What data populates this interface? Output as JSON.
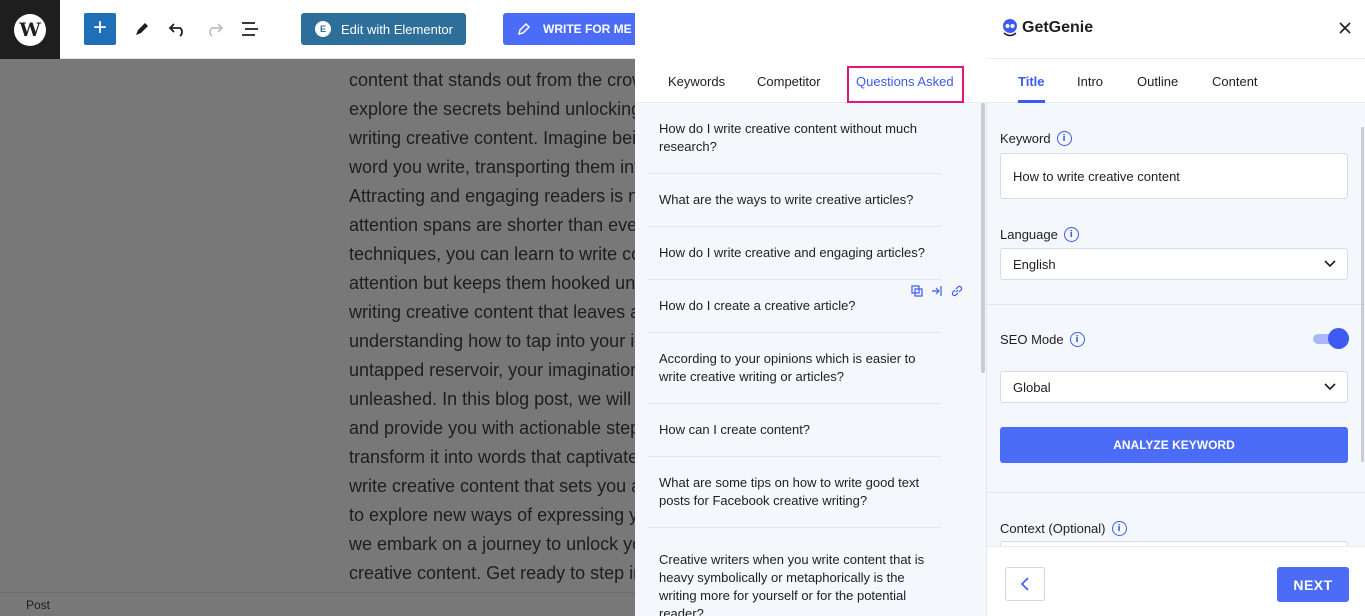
{
  "toolbar": {
    "elementor_label": "Edit with Elementor",
    "write_label": "WRITE FOR ME"
  },
  "editor": {
    "lines": [
      "content that stands out from the crowd? In this blog post, we'll",
      "explore the secrets behind unlocking your creative potential and",
      "writing creative content. Imagine being able to captivate readers with every",
      "word you write, transporting them into a world of imagination.",
      "Attracting and engaging readers is no easy task, especially when",
      "attention spans are shorter than ever. But with the right",
      "techniques, you can learn to write content that not only grabs",
      "attention but keeps them hooked until the very end. The key to",
      "writing creative content that leaves a lasting impression lies in",
      "understanding how to tap into your imagination. Like an",
      "untapped reservoir, your imagination holds endless possibilities waiting to be",
      "unleashed. In this blog post, we will take you on a journey",
      "and provide you with actionable steps to harness your creativity and",
      "transform it into words that captivate. Discover how to",
      "write creative content that sets you apart. Get ready",
      "to explore new ways of expressing yourself. Together,",
      "we embark on a journey to unlock your potential for",
      "creative content. Get ready to step into a world of creativity."
    ],
    "status": "Post"
  },
  "questions_panel": {
    "tabs": [
      "Keywords",
      "Competitor",
      "Questions Asked"
    ],
    "active_tab": "Questions Asked",
    "items": [
      "How do I write creative content without much research?",
      "What are the ways to write creative articles?",
      "How do I write creative and engaging articles?",
      "How do I create a creative article?",
      "According to your opinions which is easier to write creative writing or articles?",
      "How can I create content?",
      "What are some tips on how to write good text posts for Facebook creative writing?",
      "Creative writers when you write content that is heavy symbolically or metaphorically is the writing more for yourself or for the potential reader?"
    ]
  },
  "genie": {
    "brand": "GetGenie",
    "tabs": [
      "Title",
      "Intro",
      "Outline",
      "Content"
    ],
    "active_tab": "Title",
    "keyword_label": "Keyword",
    "keyword_value": "How to write creative content",
    "language_label": "Language",
    "language_value": "English",
    "seo_label": "SEO Mode",
    "seo_enabled": true,
    "seo_value": "Global",
    "analyze_label": "ANALYZE KEYWORD",
    "context_label": "Context (Optional)",
    "next_label": "NEXT",
    "accent": "#3d5af1"
  }
}
